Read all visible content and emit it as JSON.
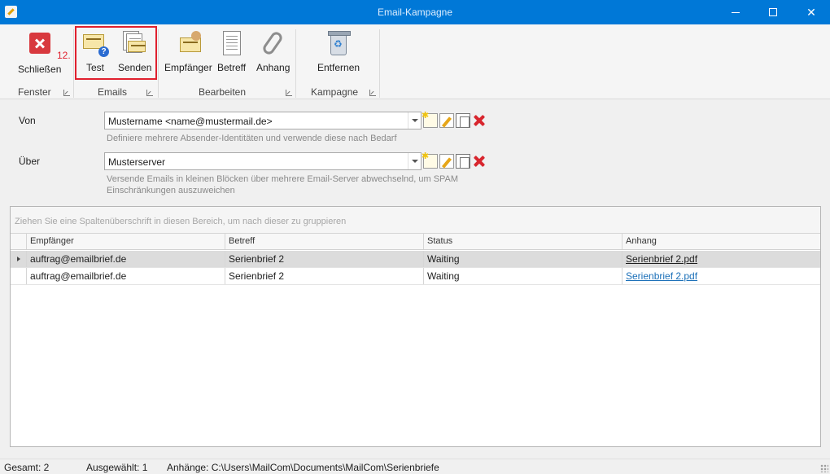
{
  "window": {
    "title": "Email-Kampagne"
  },
  "ribbon": {
    "buttons": {
      "close": "Schließen",
      "test": "Test",
      "send": "Senden",
      "recipients": "Empfänger",
      "subject": "Betreff",
      "attachment": "Anhang",
      "remove": "Entfernen"
    },
    "groups": {
      "window": "Fenster",
      "emails": "Emails",
      "edit": "Bearbeiten",
      "campaign": "Kampagne"
    },
    "step_label": "12.",
    "highlight_color": "#e0202e"
  },
  "form": {
    "from": {
      "label": "Von",
      "value": "Mustername <name@mustermail.de>",
      "hint": "Definiere mehrere Absender-Identitäten und verwende diese nach Bedarf"
    },
    "via": {
      "label": "Über",
      "value": "Musterserver",
      "hint_line1": "Versende Emails in kleinen Blöcken über mehrere Email-Server abwechselnd, um SPAM",
      "hint_line2": "Einschränkungen auszuweichen"
    }
  },
  "grid": {
    "group_panel_hint": "Ziehen Sie eine Spaltenüberschrift in diesen Bereich, um nach dieser zu gruppieren",
    "columns": [
      "Empfänger",
      "Betreff",
      "Status",
      "Anhang"
    ],
    "rows": [
      {
        "recipient": "auftrag@emailbrief.de",
        "subject": "Serienbrief 2",
        "status": "Waiting",
        "attachment": "Serienbrief 2.pdf"
      },
      {
        "recipient": "auftrag@emailbrief.de",
        "subject": "Serienbrief 2",
        "status": "Waiting",
        "attachment": "Serienbrief 2.pdf"
      }
    ]
  },
  "statusbar": {
    "total": "Gesamt: 2",
    "selected": "Ausgewählt: 1",
    "attachments": "Anhänge: C:\\Users\\MailCom\\Documents\\MailCom\\Serienbriefe"
  },
  "colors": {
    "titlebar": "#0078d7",
    "link": "#1a6fb8",
    "selected_row": "#dcdcdc"
  }
}
